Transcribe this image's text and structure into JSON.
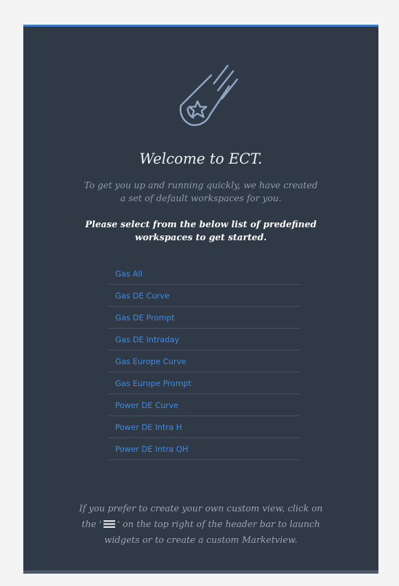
{
  "welcome": {
    "logo_icon": "shooting-star-icon",
    "title": "Welcome to ECT.",
    "subtitle": "To get you up and running quickly, we have created\na set of default workspaces for you.",
    "instruction": "Please select from the below list of predefined\nworkspaces to get started."
  },
  "workspaces": [
    "Gas All",
    "Gas DE Curve",
    "Gas DE Prompt",
    "Gas DE Intraday",
    "Gas Europe Curve",
    "Gas Europe Prompt",
    "Power DE Curve",
    "Power DE Intra H",
    "Power DE Intra QH"
  ],
  "footer": {
    "line1": "If you prefer to create your own custom view, click on",
    "line2_before_icon": "the '",
    "line2_icon": "hamburger-menu-icon",
    "line2_after_icon": "' on the top right of the header bar to launch",
    "line3": "widgets or to create a custom Marketview."
  },
  "colors": {
    "panel_background": "#2f3a46",
    "accent_top_border": "#3f79c0",
    "link": "#3d8be8",
    "muted_text": "#8f9cad"
  }
}
